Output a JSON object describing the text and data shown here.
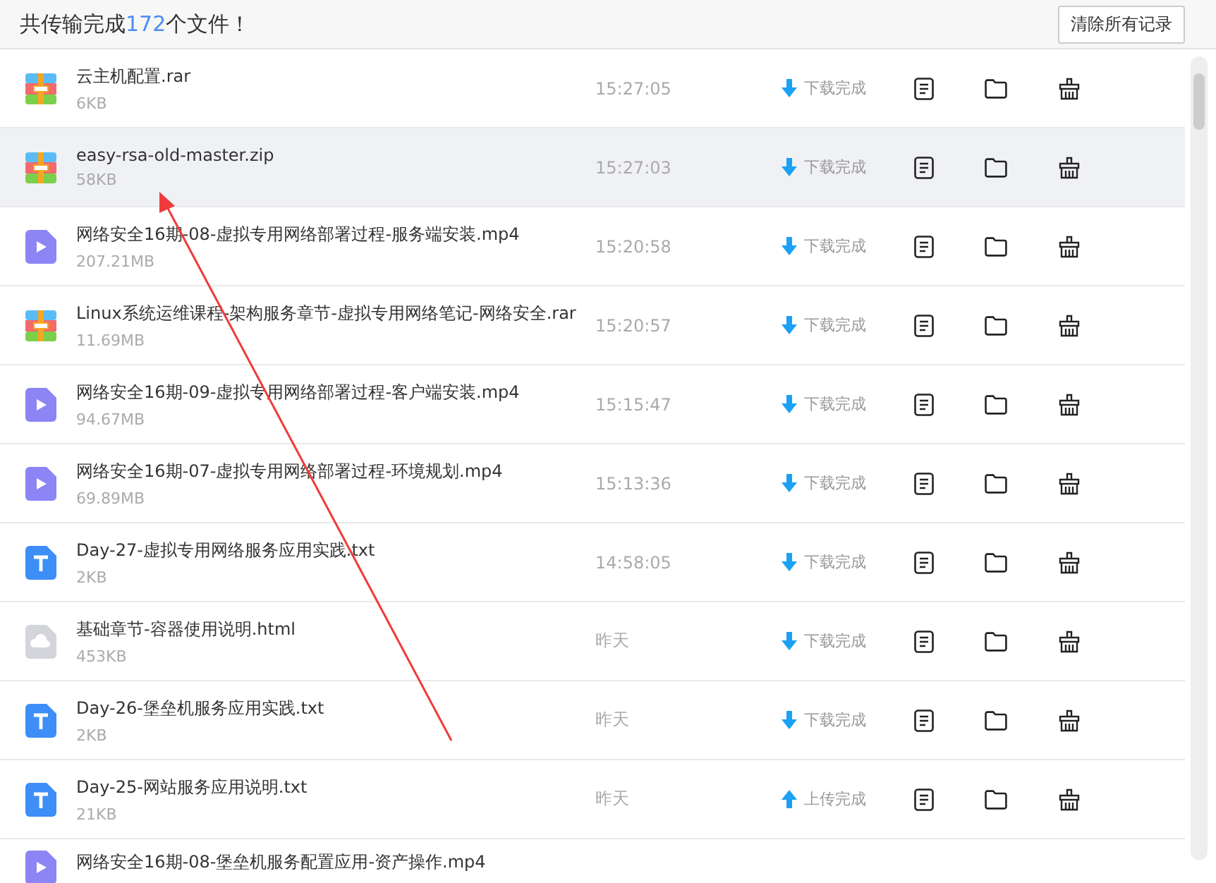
{
  "header": {
    "title_prefix": "共传输完成",
    "count": "172",
    "title_suffix": "个文件！",
    "clear_button": "清除所有记录"
  },
  "rows": [
    {
      "icon": {
        "kind": "archive"
      },
      "name": "云主机配置.rar",
      "size": "6KB",
      "time": "15:27:05",
      "status": {
        "kind": "download",
        "text": "下载完成"
      },
      "selected": false
    },
    {
      "icon": {
        "kind": "archive"
      },
      "name": "easy-rsa-old-master.zip",
      "size": "58KB",
      "time": "15:27:03",
      "status": {
        "kind": "download",
        "text": "下载完成"
      },
      "selected": true
    },
    {
      "icon": {
        "kind": "video"
      },
      "name": "网络安全16期-08-虚拟专用网络部署过程-服务端安装.mp4",
      "size": "207.21MB",
      "time": "15:20:58",
      "status": {
        "kind": "download",
        "text": "下载完成"
      },
      "selected": false
    },
    {
      "icon": {
        "kind": "archive"
      },
      "name": "Linux系统运维课程-架构服务章节-虚拟专用网络笔记-网络安全.rar",
      "size": "11.69MB",
      "time": "15:20:57",
      "status": {
        "kind": "download",
        "text": "下载完成"
      },
      "selected": false
    },
    {
      "icon": {
        "kind": "video"
      },
      "name": "网络安全16期-09-虚拟专用网络部署过程-客户端安装.mp4",
      "size": "94.67MB",
      "time": "15:15:47",
      "status": {
        "kind": "download",
        "text": "下载完成"
      },
      "selected": false
    },
    {
      "icon": {
        "kind": "video"
      },
      "name": "网络安全16期-07-虚拟专用网络部署过程-环境规划.mp4",
      "size": "69.89MB",
      "time": "15:13:36",
      "status": {
        "kind": "download",
        "text": "下载完成"
      },
      "selected": false
    },
    {
      "icon": {
        "kind": "text"
      },
      "name": "Day-27-虚拟专用网络服务应用实践.txt",
      "size": "2KB",
      "time": "14:58:05",
      "status": {
        "kind": "download",
        "text": "下载完成"
      },
      "selected": false
    },
    {
      "icon": {
        "kind": "cloud"
      },
      "name": "基础章节-容器使用说明.html",
      "size": "453KB",
      "time": "昨天",
      "status": {
        "kind": "download",
        "text": "下载完成"
      },
      "selected": false
    },
    {
      "icon": {
        "kind": "text"
      },
      "name": "Day-26-堡垒机服务应用实践.txt",
      "size": "2KB",
      "time": "昨天",
      "status": {
        "kind": "download",
        "text": "下载完成"
      },
      "selected": false
    },
    {
      "icon": {
        "kind": "text"
      },
      "name": "Day-25-网站服务应用说明.txt",
      "size": "21KB",
      "time": "昨天",
      "status": {
        "kind": "upload",
        "text": "上传完成"
      },
      "selected": false
    },
    {
      "icon": {
        "kind": "video"
      },
      "name": "网络安全16期-08-堡垒机服务配置应用-资产操作.mp4",
      "selected": false
    }
  ]
}
